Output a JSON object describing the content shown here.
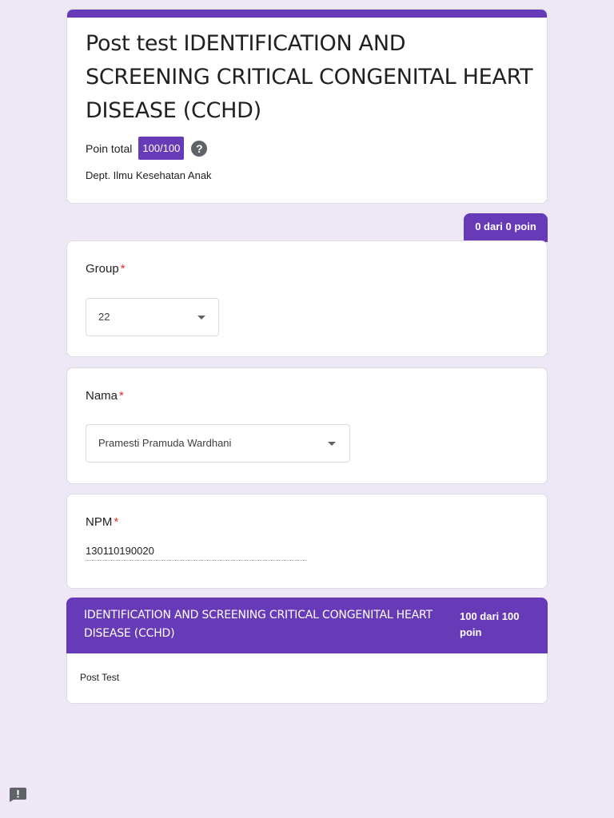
{
  "header": {
    "title": "Post test IDENTIFICATION AND SCREENING CRITICAL CONGENITAL HEART DISEASE (CCHD)",
    "points_label": "Poin total",
    "points_value": "100/100",
    "help_icon": "help-icon",
    "description": "Dept. Ilmu Kesehatan Anak"
  },
  "score_tab": {
    "label": "0 dari 0 poin"
  },
  "questions": [
    {
      "title": "Group",
      "required_mark": "*",
      "type": "dropdown",
      "value": "22"
    },
    {
      "title": "Nama",
      "required_mark": "*",
      "type": "dropdown",
      "value": "Pramesti Pramuda Wardhani"
    },
    {
      "title": "NPM",
      "required_mark": "*",
      "type": "text",
      "value": "130110190020"
    }
  ],
  "section": {
    "title": "IDENTIFICATION AND SCREENING CRITICAL CONGENITAL HEART DISEASE (CCHD)",
    "points": "100 dari 100 poin",
    "description": "Post Test"
  },
  "feedback": {
    "icon": "feedback-icon"
  },
  "colors": {
    "background": "#ede7f6",
    "accent": "#673ab7",
    "required": "#d93025"
  }
}
